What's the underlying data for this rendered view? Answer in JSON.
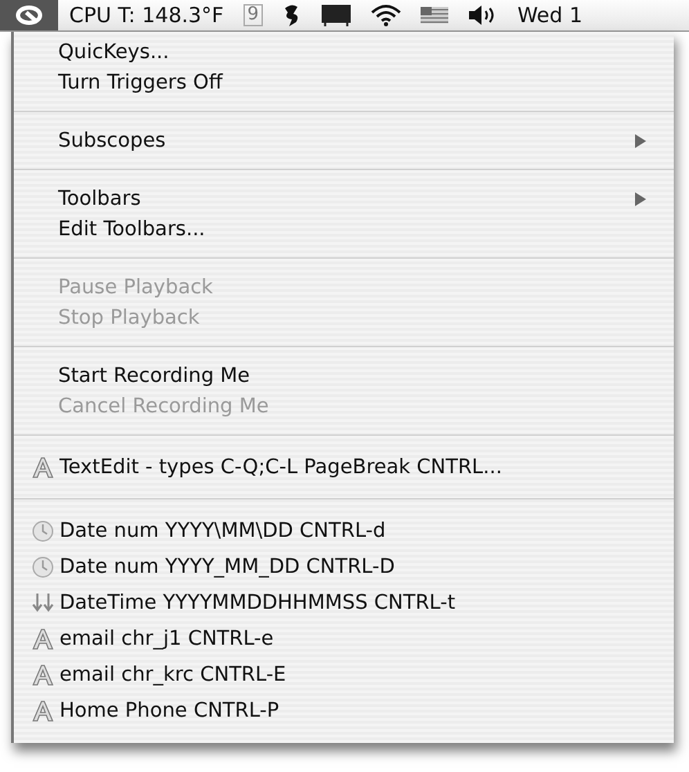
{
  "menu_bar": {
    "app_icon_selected": true,
    "cpu": "CPU T: 148.3°F",
    "spaces_badge": "9",
    "clock": "Wed 1"
  },
  "menu": {
    "groups": [
      [
        {
          "label": "QuicKeys...",
          "kind": "command",
          "disabled": false,
          "submenu": false
        },
        {
          "label": "Turn Triggers Off",
          "kind": "command",
          "disabled": false,
          "submenu": false
        }
      ],
      [
        {
          "label": "Subscopes",
          "kind": "command",
          "disabled": false,
          "submenu": true
        }
      ],
      [
        {
          "label": "Toolbars",
          "kind": "command",
          "disabled": false,
          "submenu": true
        },
        {
          "label": "Edit Toolbars...",
          "kind": "command",
          "disabled": false,
          "submenu": false
        }
      ],
      [
        {
          "label": "Pause Playback",
          "kind": "command",
          "disabled": true,
          "submenu": false
        },
        {
          "label": "Stop Playback",
          "kind": "command",
          "disabled": true,
          "submenu": false
        }
      ],
      [
        {
          "label": "Start Recording Me",
          "kind": "command",
          "disabled": false,
          "submenu": false
        },
        {
          "label": "Cancel Recording Me",
          "kind": "command",
          "disabled": true,
          "submenu": false
        }
      ],
      [
        {
          "label": "TextEdit - types C-Q;C-L PageBreak CNTRL...",
          "kind": "text",
          "disabled": false,
          "submenu": false
        }
      ],
      [
        {
          "label": "Date num YYYY\\MM\\DD CNTRL-d",
          "kind": "date",
          "disabled": false,
          "submenu": false
        },
        {
          "label": "Date num YYYY_MM_DD CNTRL-D",
          "kind": "date",
          "disabled": false,
          "submenu": false
        },
        {
          "label": "DateTime YYYYMMDDHHMMSS CNTRL-t",
          "kind": "sequence",
          "disabled": false,
          "submenu": false
        },
        {
          "label": "email chr_j1 CNTRL-e",
          "kind": "text",
          "disabled": false,
          "submenu": false
        },
        {
          "label": "email chr_krc CNTRL-E",
          "kind": "text",
          "disabled": false,
          "submenu": false
        },
        {
          "label": "Home Phone CNTRL-P",
          "kind": "text",
          "disabled": false,
          "submenu": false
        }
      ]
    ]
  }
}
